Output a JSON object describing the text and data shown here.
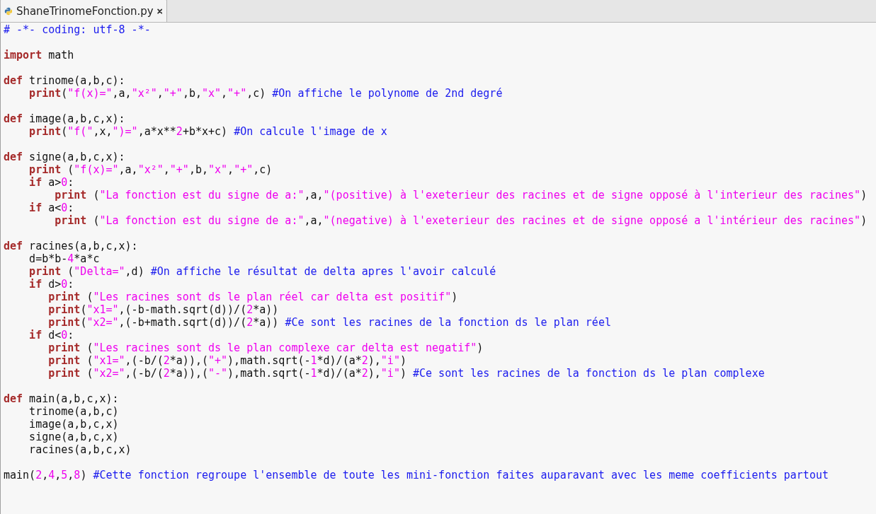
{
  "tab": {
    "title": "ShaneTrinomeFonction.py",
    "selected": true
  },
  "lines": [
    {
      "kind": "code",
      "tokens": [
        {
          "kind": "comment",
          "text": "# -*- coding: utf-8 -*-"
        }
      ]
    },
    {
      "kind": "blank"
    },
    {
      "kind": "code",
      "tokens": [
        {
          "kind": "keyword",
          "text": "import"
        },
        {
          "kind": "plain",
          "text": " math"
        }
      ]
    },
    {
      "kind": "blank"
    },
    {
      "kind": "code",
      "tokens": [
        {
          "kind": "keyword",
          "text": "def"
        },
        {
          "kind": "plain",
          "text": " trinome(a,b,c):"
        }
      ]
    },
    {
      "kind": "code",
      "tokens": [
        {
          "kind": "keyword",
          "text": "    print"
        },
        {
          "kind": "plain",
          "text": "("
        },
        {
          "kind": "string",
          "text": "\"f(x)=\""
        },
        {
          "kind": "plain",
          "text": ",a,"
        },
        {
          "kind": "string",
          "text": "\"x²\""
        },
        {
          "kind": "plain",
          "text": ","
        },
        {
          "kind": "string",
          "text": "\"+\""
        },
        {
          "kind": "plain",
          "text": ",b,"
        },
        {
          "kind": "string",
          "text": "\"x\""
        },
        {
          "kind": "plain",
          "text": ","
        },
        {
          "kind": "string",
          "text": "\"+\""
        },
        {
          "kind": "plain",
          "text": ",c) "
        },
        {
          "kind": "comment",
          "text": "#On affiche le polynome de 2nd degré"
        }
      ]
    },
    {
      "kind": "blank"
    },
    {
      "kind": "code",
      "tokens": [
        {
          "kind": "keyword",
          "text": "def"
        },
        {
          "kind": "plain",
          "text": " image(a,b,c,x):"
        }
      ]
    },
    {
      "kind": "code",
      "tokens": [
        {
          "kind": "keyword",
          "text": "    print"
        },
        {
          "kind": "plain",
          "text": "("
        },
        {
          "kind": "string",
          "text": "\"f(\""
        },
        {
          "kind": "plain",
          "text": ",x,"
        },
        {
          "kind": "string",
          "text": "\")=\""
        },
        {
          "kind": "plain",
          "text": ",a*x**"
        },
        {
          "kind": "number",
          "text": "2"
        },
        {
          "kind": "plain",
          "text": "+b*x+c) "
        },
        {
          "kind": "comment",
          "text": "#On calcule l'image de x"
        }
      ]
    },
    {
      "kind": "blank"
    },
    {
      "kind": "code",
      "tokens": [
        {
          "kind": "keyword",
          "text": "def"
        },
        {
          "kind": "plain",
          "text": " signe(a,b,c,x):"
        }
      ]
    },
    {
      "kind": "code",
      "tokens": [
        {
          "kind": "keyword",
          "text": "    print"
        },
        {
          "kind": "plain",
          "text": " ("
        },
        {
          "kind": "string",
          "text": "\"f(x)=\""
        },
        {
          "kind": "plain",
          "text": ",a,"
        },
        {
          "kind": "string",
          "text": "\"x²\""
        },
        {
          "kind": "plain",
          "text": ","
        },
        {
          "kind": "string",
          "text": "\"+\""
        },
        {
          "kind": "plain",
          "text": ",b,"
        },
        {
          "kind": "string",
          "text": "\"x\""
        },
        {
          "kind": "plain",
          "text": ","
        },
        {
          "kind": "string",
          "text": "\"+\""
        },
        {
          "kind": "plain",
          "text": ",c)"
        }
      ]
    },
    {
      "kind": "code",
      "tokens": [
        {
          "kind": "keyword",
          "text": "    if"
        },
        {
          "kind": "plain",
          "text": " a>"
        },
        {
          "kind": "number",
          "text": "0"
        },
        {
          "kind": "plain",
          "text": ":"
        }
      ]
    },
    {
      "kind": "code",
      "tokens": [
        {
          "kind": "keyword",
          "text": "        print"
        },
        {
          "kind": "plain",
          "text": " ("
        },
        {
          "kind": "string",
          "text": "\"La fonction est du signe de a:\""
        },
        {
          "kind": "plain",
          "text": ",a,"
        },
        {
          "kind": "string",
          "text": "\"(positive) à l'exeterieur des racines et de signe opposé à l'interieur des racines\""
        },
        {
          "kind": "plain",
          "text": ")"
        }
      ]
    },
    {
      "kind": "code",
      "tokens": [
        {
          "kind": "keyword",
          "text": "    if"
        },
        {
          "kind": "plain",
          "text": " a<"
        },
        {
          "kind": "number",
          "text": "0"
        },
        {
          "kind": "plain",
          "text": ":"
        }
      ]
    },
    {
      "kind": "code",
      "tokens": [
        {
          "kind": "keyword",
          "text": "        print"
        },
        {
          "kind": "plain",
          "text": " ("
        },
        {
          "kind": "string",
          "text": "\"La fonction est du signe de a:\""
        },
        {
          "kind": "plain",
          "text": ",a,"
        },
        {
          "kind": "string",
          "text": "\"(negative) à l'exeterieur des racines et de signe opposé a l'intérieur des racines\""
        },
        {
          "kind": "plain",
          "text": ")"
        }
      ]
    },
    {
      "kind": "blank"
    },
    {
      "kind": "code",
      "tokens": [
        {
          "kind": "keyword",
          "text": "def"
        },
        {
          "kind": "plain",
          "text": " racines(a,b,c,x):"
        }
      ]
    },
    {
      "kind": "code",
      "tokens": [
        {
          "kind": "plain",
          "text": "    d=b*b-"
        },
        {
          "kind": "number",
          "text": "4"
        },
        {
          "kind": "plain",
          "text": "*a*c"
        }
      ]
    },
    {
      "kind": "code",
      "tokens": [
        {
          "kind": "keyword",
          "text": "    print"
        },
        {
          "kind": "plain",
          "text": " ("
        },
        {
          "kind": "string",
          "text": "\"Delta=\""
        },
        {
          "kind": "plain",
          "text": ",d) "
        },
        {
          "kind": "comment",
          "text": "#On affiche le résultat de delta apres l'avoir calculé"
        }
      ]
    },
    {
      "kind": "code",
      "tokens": [
        {
          "kind": "keyword",
          "text": "    if"
        },
        {
          "kind": "plain",
          "text": " d>"
        },
        {
          "kind": "number",
          "text": "0"
        },
        {
          "kind": "plain",
          "text": ":"
        }
      ]
    },
    {
      "kind": "code",
      "tokens": [
        {
          "kind": "keyword",
          "text": "       print"
        },
        {
          "kind": "plain",
          "text": " ("
        },
        {
          "kind": "string",
          "text": "\"Les racines sont ds le plan réel car delta est positif\""
        },
        {
          "kind": "plain",
          "text": ")"
        }
      ]
    },
    {
      "kind": "code",
      "tokens": [
        {
          "kind": "keyword",
          "text": "       print"
        },
        {
          "kind": "plain",
          "text": "("
        },
        {
          "kind": "string",
          "text": "\"x1=\""
        },
        {
          "kind": "plain",
          "text": ",(-b-math.sqrt(d))/("
        },
        {
          "kind": "number",
          "text": "2"
        },
        {
          "kind": "plain",
          "text": "*a))"
        }
      ]
    },
    {
      "kind": "code",
      "tokens": [
        {
          "kind": "keyword",
          "text": "       print"
        },
        {
          "kind": "plain",
          "text": "("
        },
        {
          "kind": "string",
          "text": "\"x2=\""
        },
        {
          "kind": "plain",
          "text": ",(-b+math.sqrt(d))/("
        },
        {
          "kind": "number",
          "text": "2"
        },
        {
          "kind": "plain",
          "text": "*a)) "
        },
        {
          "kind": "comment",
          "text": "#Ce sont les racines de la fonction ds le plan réel"
        }
      ]
    },
    {
      "kind": "code",
      "tokens": [
        {
          "kind": "keyword",
          "text": "    if"
        },
        {
          "kind": "plain",
          "text": " d<"
        },
        {
          "kind": "number",
          "text": "0"
        },
        {
          "kind": "plain",
          "text": ":"
        }
      ]
    },
    {
      "kind": "code",
      "tokens": [
        {
          "kind": "keyword",
          "text": "       print"
        },
        {
          "kind": "plain",
          "text": " ("
        },
        {
          "kind": "string",
          "text": "\"Les racines sont ds le plan complexe car delta est negatif\""
        },
        {
          "kind": "plain",
          "text": ")"
        }
      ]
    },
    {
      "kind": "code",
      "tokens": [
        {
          "kind": "keyword",
          "text": "       print"
        },
        {
          "kind": "plain",
          "text": " ("
        },
        {
          "kind": "string",
          "text": "\"x1=\""
        },
        {
          "kind": "plain",
          "text": ",(-b/("
        },
        {
          "kind": "number",
          "text": "2"
        },
        {
          "kind": "plain",
          "text": "*a)),("
        },
        {
          "kind": "string",
          "text": "\"+\""
        },
        {
          "kind": "plain",
          "text": "),math.sqrt(-"
        },
        {
          "kind": "number",
          "text": "1"
        },
        {
          "kind": "plain",
          "text": "*d)/(a*"
        },
        {
          "kind": "number",
          "text": "2"
        },
        {
          "kind": "plain",
          "text": "),"
        },
        {
          "kind": "string",
          "text": "\"i\""
        },
        {
          "kind": "plain",
          "text": ")"
        }
      ]
    },
    {
      "kind": "code",
      "tokens": [
        {
          "kind": "keyword",
          "text": "       print"
        },
        {
          "kind": "plain",
          "text": " ("
        },
        {
          "kind": "string",
          "text": "\"x2=\""
        },
        {
          "kind": "plain",
          "text": ",(-b/("
        },
        {
          "kind": "number",
          "text": "2"
        },
        {
          "kind": "plain",
          "text": "*a)),("
        },
        {
          "kind": "string",
          "text": "\"-\""
        },
        {
          "kind": "plain",
          "text": "),math.sqrt(-"
        },
        {
          "kind": "number",
          "text": "1"
        },
        {
          "kind": "plain",
          "text": "*d)/(a*"
        },
        {
          "kind": "number",
          "text": "2"
        },
        {
          "kind": "plain",
          "text": "),"
        },
        {
          "kind": "string",
          "text": "\"i\""
        },
        {
          "kind": "plain",
          "text": ") "
        },
        {
          "kind": "comment",
          "text": "#Ce sont les racines de la fonction ds le plan complexe"
        }
      ]
    },
    {
      "kind": "blank"
    },
    {
      "kind": "code",
      "tokens": [
        {
          "kind": "keyword",
          "text": "def"
        },
        {
          "kind": "plain",
          "text": " main(a,b,c,x):"
        }
      ]
    },
    {
      "kind": "code",
      "tokens": [
        {
          "kind": "plain",
          "text": "    trinome(a,b,c)"
        }
      ]
    },
    {
      "kind": "code",
      "tokens": [
        {
          "kind": "plain",
          "text": "    image(a,b,c,x)"
        }
      ]
    },
    {
      "kind": "code",
      "tokens": [
        {
          "kind": "plain",
          "text": "    signe(a,b,c,x)"
        }
      ]
    },
    {
      "kind": "code",
      "tokens": [
        {
          "kind": "plain",
          "text": "    racines(a,b,c,x)"
        }
      ]
    },
    {
      "kind": "blank"
    },
    {
      "kind": "code",
      "tokens": [
        {
          "kind": "plain",
          "text": "main("
        },
        {
          "kind": "number",
          "text": "2"
        },
        {
          "kind": "plain",
          "text": ","
        },
        {
          "kind": "number",
          "text": "4"
        },
        {
          "kind": "plain",
          "text": ","
        },
        {
          "kind": "number",
          "text": "5"
        },
        {
          "kind": "plain",
          "text": ","
        },
        {
          "kind": "number",
          "text": "8"
        },
        {
          "kind": "plain",
          "text": ") "
        },
        {
          "kind": "comment",
          "text": "#Cette fonction regroupe l'ensemble de toute les mini-fonction faites auparavant avec les meme coefficients partout"
        }
      ]
    }
  ]
}
